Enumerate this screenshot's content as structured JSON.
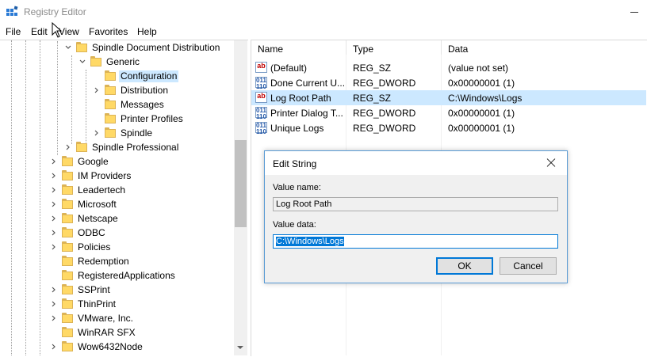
{
  "window": {
    "title": "Registry Editor"
  },
  "menu": [
    "File",
    "Edit",
    "View",
    "Favorites",
    "Help"
  ],
  "tree": {
    "rows": [
      {
        "label": "Spindle Document Distribution",
        "level": 2,
        "expander": "open"
      },
      {
        "label": "Generic",
        "level": 3,
        "expander": "open"
      },
      {
        "label": "Configuration",
        "level": 4,
        "expander": "none",
        "selected": true
      },
      {
        "label": "Distribution",
        "level": 4,
        "expander": "closed"
      },
      {
        "label": "Messages",
        "level": 4,
        "expander": "none"
      },
      {
        "label": "Printer Profiles",
        "level": 4,
        "expander": "none"
      },
      {
        "label": "Spindle",
        "level": 4,
        "expander": "closed"
      },
      {
        "label": "Spindle Professional",
        "level": 2,
        "expander": "closed"
      },
      {
        "label": "Google",
        "level": 1,
        "expander": "closed"
      },
      {
        "label": "IM Providers",
        "level": 1,
        "expander": "closed"
      },
      {
        "label": "Leadertech",
        "level": 1,
        "expander": "closed"
      },
      {
        "label": "Microsoft",
        "level": 1,
        "expander": "closed"
      },
      {
        "label": "Netscape",
        "level": 1,
        "expander": "closed"
      },
      {
        "label": "ODBC",
        "level": 1,
        "expander": "closed"
      },
      {
        "label": "Policies",
        "level": 1,
        "expander": "closed"
      },
      {
        "label": "Redemption",
        "level": 1,
        "expander": "none"
      },
      {
        "label": "RegisteredApplications",
        "level": 1,
        "expander": "none"
      },
      {
        "label": "SSPrint",
        "level": 1,
        "expander": "closed"
      },
      {
        "label": "ThinPrint",
        "level": 1,
        "expander": "closed"
      },
      {
        "label": "VMware, Inc.",
        "level": 1,
        "expander": "closed"
      },
      {
        "label": "WinRAR SFX",
        "level": 1,
        "expander": "none"
      },
      {
        "label": "Wow6432Node",
        "level": 1,
        "expander": "closed"
      }
    ]
  },
  "list": {
    "columns": [
      "Name",
      "Type",
      "Data"
    ],
    "rows": [
      {
        "name": "(Default)",
        "type": "REG_SZ",
        "data": "(value not set)",
        "icon": "string-value-icon",
        "kind": "sz"
      },
      {
        "name": "Done Current U...",
        "type": "REG_DWORD",
        "data": "0x00000001 (1)",
        "icon": "dword-value-icon",
        "kind": "dword"
      },
      {
        "name": "Log Root Path",
        "type": "REG_SZ",
        "data": "C:\\Windows\\Logs",
        "icon": "string-value-icon",
        "kind": "sz",
        "selected": true
      },
      {
        "name": "Printer Dialog T...",
        "type": "REG_DWORD",
        "data": "0x00000001 (1)",
        "icon": "dword-value-icon",
        "kind": "dword"
      },
      {
        "name": "Unique Logs",
        "type": "REG_DWORD",
        "data": "0x00000001 (1)",
        "icon": "dword-value-icon",
        "kind": "dword"
      }
    ]
  },
  "dialog": {
    "title": "Edit String",
    "value_name_label": "Value name:",
    "value_name": "Log Root Path",
    "value_data_label": "Value data:",
    "value_data": "C:\\Windows\\Logs",
    "ok_label": "OK",
    "cancel_label": "Cancel"
  },
  "colors": {
    "accent": "#0078d7",
    "selection": "#cce8ff",
    "folder": "#ffd966"
  }
}
